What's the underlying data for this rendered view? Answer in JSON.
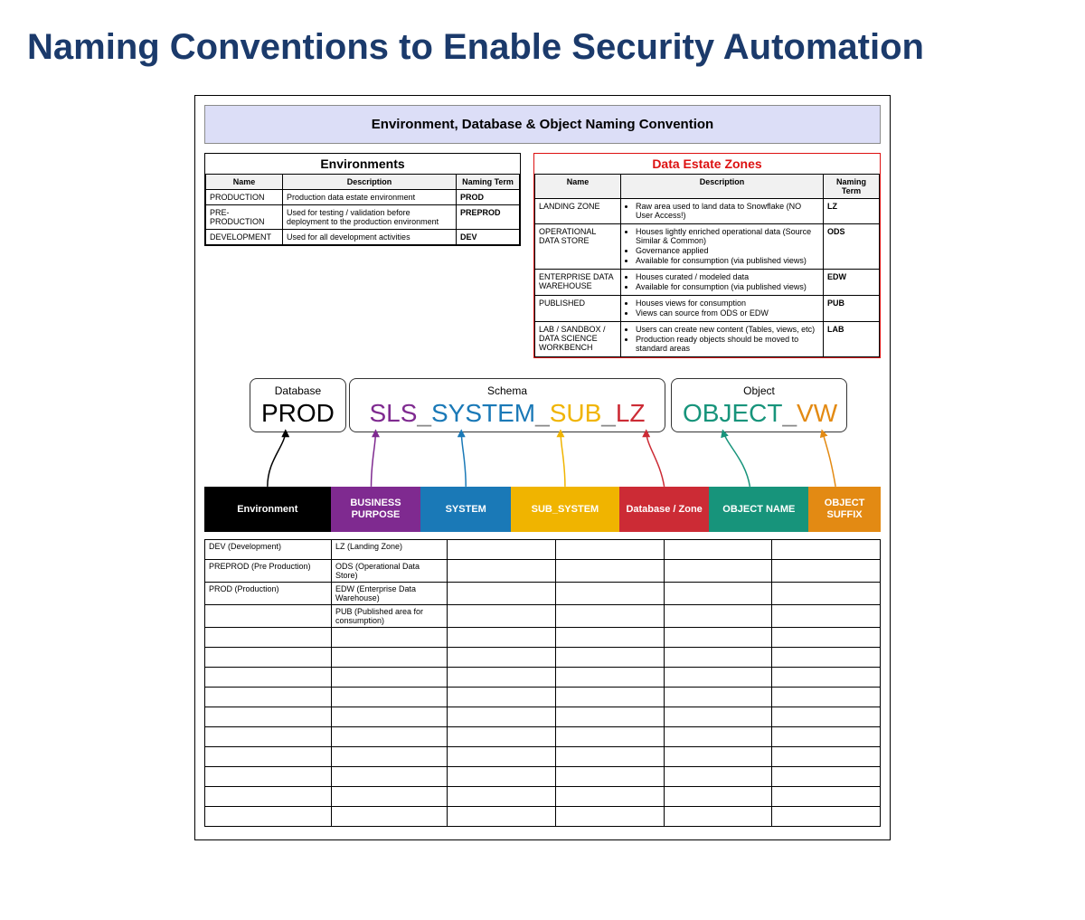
{
  "title": "Naming Conventions to Enable Security Automation",
  "panel_title": "Environment, Database & Object Naming Convention",
  "env_table": {
    "caption": "Environments",
    "headers": {
      "name": "Name",
      "desc": "Description",
      "term": "Naming Term"
    },
    "rows": [
      {
        "name": "PRODUCTION",
        "desc": "Production data estate environment",
        "term": "PROD"
      },
      {
        "name": "PRE-PRODUCTION",
        "desc": "Used for testing / validation before deployment to the production environment",
        "term": "PREPROD"
      },
      {
        "name": "DEVELOPMENT",
        "desc": "Used for all development activities",
        "term": "DEV"
      }
    ]
  },
  "zone_table": {
    "caption": "Data Estate Zones",
    "headers": {
      "name": "Name",
      "desc": "Description",
      "term": "Naming Term"
    },
    "rows": [
      {
        "name": "LANDING ZONE",
        "desc": [
          "Raw area used to land data to Snowflake (NO User Access!)"
        ],
        "term": "LZ"
      },
      {
        "name": "OPERATIONAL DATA STORE",
        "desc": [
          "Houses lightly enriched operational data (Source Similar & Common)",
          "Governance applied",
          "Available for consumption (via published views)"
        ],
        "term": "ODS"
      },
      {
        "name": "ENTERPRISE DATA WAREHOUSE",
        "desc": [
          "Houses curated / modeled data",
          "Available for consumption  (via published views)"
        ],
        "term": "EDW"
      },
      {
        "name": "PUBLISHED",
        "desc": [
          "Houses views for consumption",
          "Views can source from ODS or EDW"
        ],
        "term": "PUB"
      },
      {
        "name": "LAB / SANDBOX / DATA SCIENCE WORKBENCH",
        "desc": [
          "Users can create new content (Tables, views, etc)",
          "Production ready objects should be moved to standard areas"
        ],
        "term": "LAB"
      }
    ]
  },
  "example": {
    "db_label": "Database",
    "schema_label": "Schema",
    "object_label": "Object",
    "db": "PROD",
    "schema_parts": {
      "pur": "SLS",
      "sys": "SYSTEM",
      "sub": "SUB",
      "zone": "LZ"
    },
    "object_parts": {
      "obj": "OBJECT",
      "suf": "VW"
    }
  },
  "strip": {
    "env": "Environment",
    "pur": "BUSINESS PURPOSE",
    "sys": "SYSTEM",
    "sub": "SUB_SYSTEM",
    "zone": "Database / Zone",
    "obj": "OBJECT NAME",
    "suf": "OBJECT SUFFIX"
  },
  "bottom_grid": {
    "col0": [
      "DEV (Development)",
      "PREPROD (Pre Production)",
      "PROD (Production)"
    ],
    "col1": [
      "LZ (Landing Zone)",
      "ODS (Operational Data Store)",
      "EDW (Enterprise Data Warehouse)",
      "PUB (Published area for consumption)"
    ],
    "total_rows": 14
  },
  "colors": {
    "env": "#000000",
    "pur": "#7f2a90",
    "sys": "#1a79b7",
    "sub": "#f0b400",
    "zone": "#cc2b35",
    "obj": "#17947b",
    "suf": "#e38a13"
  }
}
